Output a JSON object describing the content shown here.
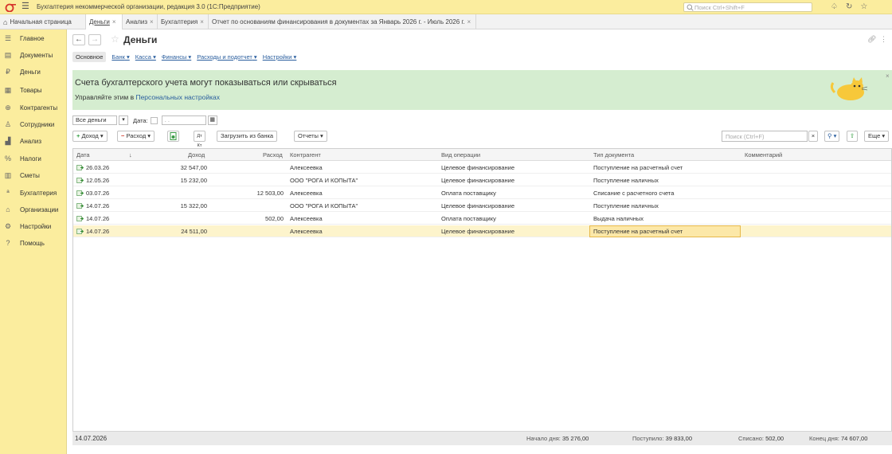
{
  "app": {
    "title": "Бухгалтерия некоммерческой организации, редакция 3.0  (1С:Предприятие)",
    "search_placeholder": "Поиск Ctrl+Shift+F"
  },
  "tabs": [
    {
      "label": "Начальная страница"
    },
    {
      "label": "Деньги"
    },
    {
      "label": "Анализ"
    },
    {
      "label": "Бухгалтерия"
    },
    {
      "label": "Отчет по основаниям финансирования в документах за Январь 2026 г. - Июль 2026 г."
    }
  ],
  "sidebar": {
    "items": [
      {
        "label": "Главное",
        "icon": "menu-icon"
      },
      {
        "label": "Документы",
        "icon": "documents-icon"
      },
      {
        "label": "Деньги",
        "icon": "ruble-icon"
      },
      {
        "label": "Товары",
        "icon": "goods-icon"
      },
      {
        "label": "Контрагенты",
        "icon": "contractors-icon"
      },
      {
        "label": "Сотрудники",
        "icon": "employees-icon"
      },
      {
        "label": "Анализ",
        "icon": "analysis-icon"
      },
      {
        "label": "Налоги",
        "icon": "percent-icon"
      },
      {
        "label": "Сметы",
        "icon": "budget-icon"
      },
      {
        "label": "Бухгалтерия",
        "icon": "accounting-icon"
      },
      {
        "label": "Организации",
        "icon": "organizations-icon"
      },
      {
        "label": "Настройки",
        "icon": "settings-icon"
      },
      {
        "label": "Помощь",
        "icon": "help-icon"
      }
    ]
  },
  "page": {
    "title": "Деньги",
    "subtabs": [
      "Основное",
      "Банк",
      "Касса",
      "Финансы",
      "Расходы и подотчет",
      "Настройки"
    ]
  },
  "banner": {
    "title": "Счета бухгалтерского учета могут показываться или скрываться",
    "text": "Управляйте этим в ",
    "link": "Персональных настройках",
    "close": "×"
  },
  "filters": {
    "money_select": "Все деньги",
    "date_label": "Дата:",
    "date_value": ". ."
  },
  "toolbar": {
    "income": "Доход",
    "expense": "Расход",
    "load_bank": "Загрузить из банка",
    "reports": "Отчеты",
    "search_placeholder": "Поиск (Ctrl+F)",
    "more": "Еще"
  },
  "table": {
    "columns": [
      "Дата",
      "Доход",
      "Расход",
      "Контрагент",
      "Вид операции",
      "Тип документа",
      "Комментарий"
    ],
    "rows": [
      {
        "date": "26.03.26",
        "income": "32 547,00",
        "expense": "",
        "counterparty": "Алексеевка",
        "operation": "Целевое финансирование",
        "doc_type": "Поступление на расчетный счет",
        "comment": ""
      },
      {
        "date": "12.05.26",
        "income": "15 232,00",
        "expense": "",
        "counterparty": "ООО \"РОГА И КОПЫТА\"",
        "operation": "Целевое финансирование",
        "doc_type": "Поступление наличных",
        "comment": ""
      },
      {
        "date": "03.07.26",
        "income": "",
        "expense": "12 503,00",
        "counterparty": "Алексеевка",
        "operation": "Оплата поставщику",
        "doc_type": "Списание с расчетного счета",
        "comment": ""
      },
      {
        "date": "14.07.26",
        "income": "15 322,00",
        "expense": "",
        "counterparty": "ООО \"РОГА И КОПЫТА\"",
        "operation": "Целевое финансирование",
        "doc_type": "Поступление наличных",
        "comment": ""
      },
      {
        "date": "14.07.26",
        "income": "",
        "expense": "502,00",
        "counterparty": "Алексеевка",
        "operation": "Оплата поставщику",
        "doc_type": "Выдача наличных",
        "comment": ""
      },
      {
        "date": "14.07.26",
        "income": "24 511,00",
        "expense": "",
        "counterparty": "Алексеевка",
        "operation": "Целевое финансирование",
        "doc_type": "Поступление на расчетный счет",
        "comment": ""
      }
    ],
    "selected_row": 5
  },
  "footer": {
    "date": "14.07.2026",
    "start_label": "Начало дня:",
    "start_value": "35 276,00",
    "received_label": "Поступило:",
    "received_value": "39 833,00",
    "spent_label": "Списано:",
    "spent_value": "502,00",
    "end_label": "Конец дня:",
    "end_value": "74 607,00"
  },
  "colors": {
    "accent_yellow": "#fbed9e",
    "banner_green": "#d5edd0",
    "link_blue": "#2a5e9e",
    "selected_row": "#fdf4cc"
  }
}
